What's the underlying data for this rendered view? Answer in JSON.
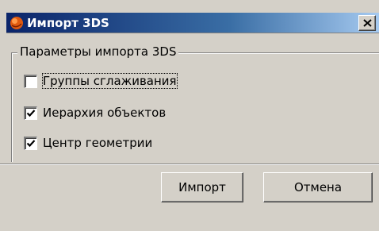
{
  "window": {
    "title": "Импорт 3DS",
    "close_icon": "close-icon",
    "app_icon": "app-icon"
  },
  "group": {
    "caption": "Параметры импорта 3DS",
    "options": [
      {
        "label": "Группы сглаживания",
        "checked": false
      },
      {
        "label": "Иерархия объектов",
        "checked": true
      },
      {
        "label": "Центр геометрии",
        "checked": true
      }
    ]
  },
  "buttons": {
    "import_label": "Импорт",
    "cancel_label": "Отмена"
  },
  "colors": {
    "titlebar_start": "#0a246a",
    "titlebar_end": "#a6caf0",
    "face": "#d4d0c8"
  }
}
